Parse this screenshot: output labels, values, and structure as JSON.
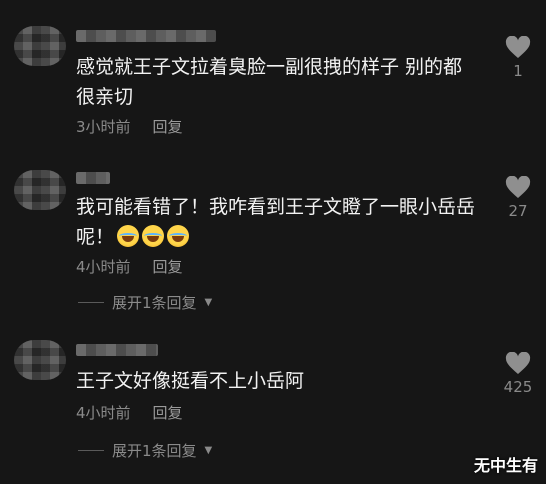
{
  "comments": [
    {
      "text": "感觉就王子文拉着臭脸一副很拽的样子 别的都很亲切",
      "time": "3小时前",
      "reply_label": "回复",
      "likes": "1"
    },
    {
      "text": "我可能看错了！我咋看到王子文瞪了一眼小岳岳呢！",
      "time": "4小时前",
      "reply_label": "回复",
      "likes": "27",
      "expand_label": "展开1条回复"
    },
    {
      "text": "王子文好像挺看不上小岳阿",
      "time": "4小时前",
      "reply_label": "回复",
      "likes": "425",
      "expand_label": "展开1条回复"
    }
  ],
  "watermark": "无中生有",
  "icons": {
    "like": "heart-icon",
    "expand": "caret-down-icon",
    "emoji": "laughing-crying-emoji"
  }
}
